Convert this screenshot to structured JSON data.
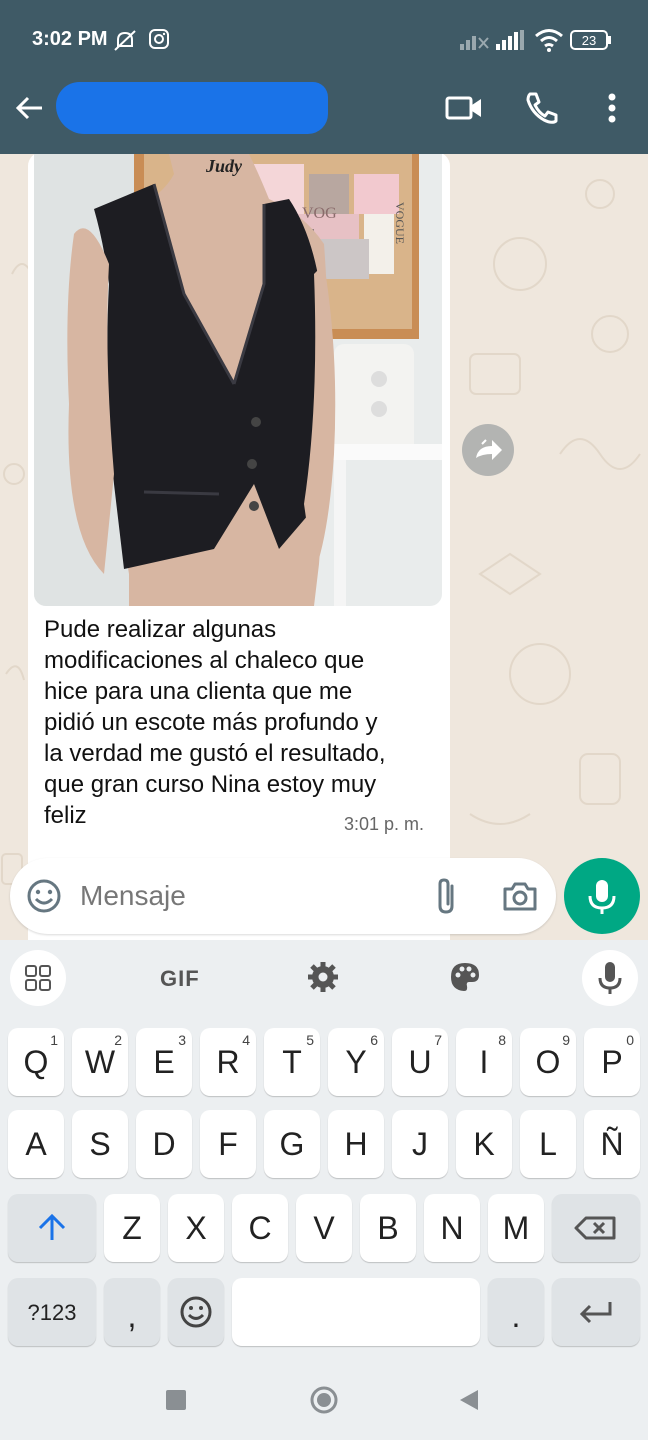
{
  "status_bar": {
    "time": "3:02 PM",
    "battery": "23"
  },
  "header": {
    "contact_name": ""
  },
  "message": {
    "text": "Pude realizar algunas modificaciones al chaleco que hice para una clienta que me pidió un escote más profundo y la verdad me gustó el resultado, que gran curso Nina estoy muy feliz",
    "lines": [
      "Pude realizar algunas",
      "modificaciones al chaleco que",
      "hice para una clienta que me",
      "pidió un escote más profundo y",
      "la verdad me gustó el resultado,",
      "que gran curso Nina estoy muy",
      "feliz"
    ],
    "time": "3:01 p. m.",
    "photo_text": [
      "Judy",
      "VOG",
      "VOGUE"
    ]
  },
  "composer": {
    "placeholder": "Mensaje"
  },
  "keyboard": {
    "gif_label": "GIF",
    "row1": [
      {
        "ch": "Q",
        "hint": "1"
      },
      {
        "ch": "W",
        "hint": "2"
      },
      {
        "ch": "E",
        "hint": "3"
      },
      {
        "ch": "R",
        "hint": "4"
      },
      {
        "ch": "T",
        "hint": "5"
      },
      {
        "ch": "Y",
        "hint": "6"
      },
      {
        "ch": "U",
        "hint": "7"
      },
      {
        "ch": "I",
        "hint": "8"
      },
      {
        "ch": "O",
        "hint": "9"
      },
      {
        "ch": "P",
        "hint": "0"
      }
    ],
    "row2": [
      "A",
      "S",
      "D",
      "F",
      "G",
      "H",
      "J",
      "K",
      "L",
      "Ñ"
    ],
    "row3": [
      "Z",
      "X",
      "C",
      "V",
      "B",
      "N",
      "M"
    ],
    "symbols_label": "?123",
    "comma": ",",
    "period": "."
  },
  "colors": {
    "header": "#3f5a66",
    "accent": "#00a884",
    "chat_bg": "#efe7dd",
    "redaction": "#1a73e8"
  },
  "icons": [
    "back-arrow-icon",
    "video-call-icon",
    "phone-icon",
    "more-vert-icon",
    "forward-icon",
    "emoji-icon",
    "attach-icon",
    "camera-icon",
    "mic-icon",
    "grid-icon",
    "settings-icon",
    "palette-icon",
    "shift-icon",
    "backspace-icon",
    "enter-icon"
  ]
}
